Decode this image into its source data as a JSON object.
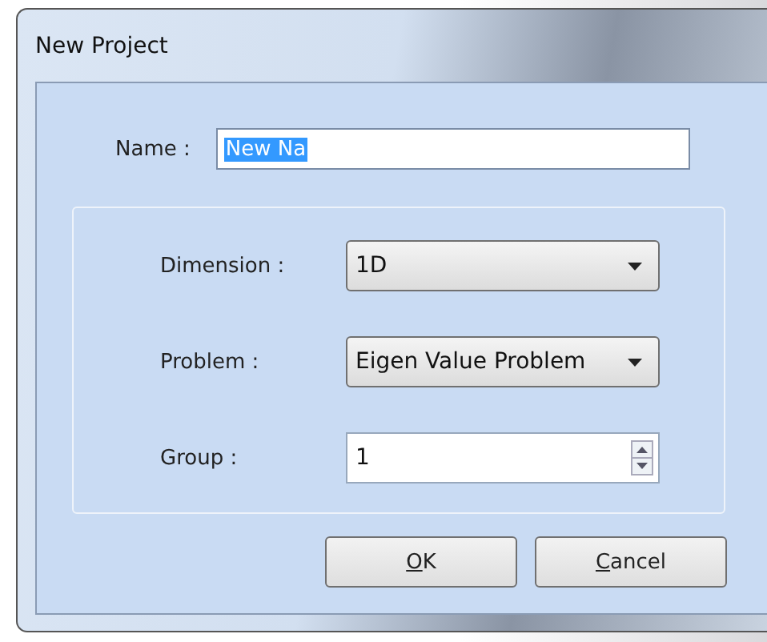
{
  "window": {
    "title": "New Project"
  },
  "name_field": {
    "label": "Name :",
    "value": "New Na",
    "selected": true
  },
  "fields": [
    {
      "kind": "dropdown",
      "label": "Dimension :",
      "value": "1D"
    },
    {
      "kind": "dropdown",
      "label": "Problem :",
      "value": "Eigen Value Problem"
    },
    {
      "kind": "spinner",
      "label": "Group :",
      "value": "1"
    }
  ],
  "buttons": [
    {
      "label": "OK"
    },
    {
      "label": "Cancel"
    }
  ]
}
